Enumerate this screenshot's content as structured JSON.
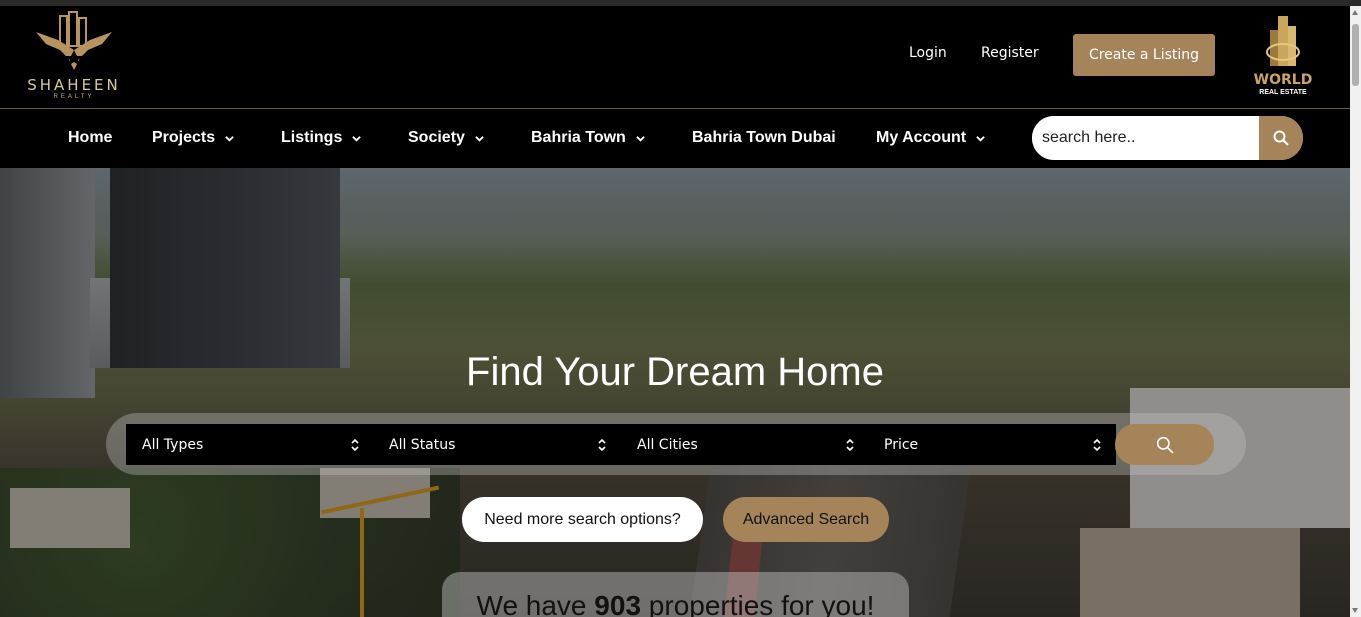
{
  "header": {
    "logo": {
      "name": "SHAHEEN",
      "sub": "REALTY"
    },
    "login_label": "Login",
    "register_label": "Register",
    "create_listing_label": "Create a Listing",
    "partner_logo": {
      "name": "WORLD",
      "sub": "REAL ESTATE"
    }
  },
  "nav": {
    "items": [
      {
        "label": "Home",
        "dropdown": false
      },
      {
        "label": "Projects",
        "dropdown": true
      },
      {
        "label": "Listings",
        "dropdown": true
      },
      {
        "label": "Society",
        "dropdown": true
      },
      {
        "label": "Bahria Town",
        "dropdown": true
      },
      {
        "label": "Bahria Town Dubai",
        "dropdown": false
      },
      {
        "label": "My Account",
        "dropdown": true
      }
    ],
    "search": {
      "placeholder": "search here..",
      "icon": "search-icon"
    }
  },
  "hero": {
    "title": "Find Your Dream Home",
    "filters": [
      {
        "selected": "All Types"
      },
      {
        "selected": "All Status"
      },
      {
        "selected": "All Cities"
      },
      {
        "selected": "Price"
      }
    ],
    "search_icon": "search-icon",
    "more_options_label": "Need more search options?",
    "advanced_search_label": "Advanced Search",
    "count": {
      "prefix": "We have ",
      "number": "903",
      "suffix": " properties for you!"
    }
  },
  "colors": {
    "accent": "#a6845a",
    "background": "#000000",
    "text": "#ffffff"
  }
}
